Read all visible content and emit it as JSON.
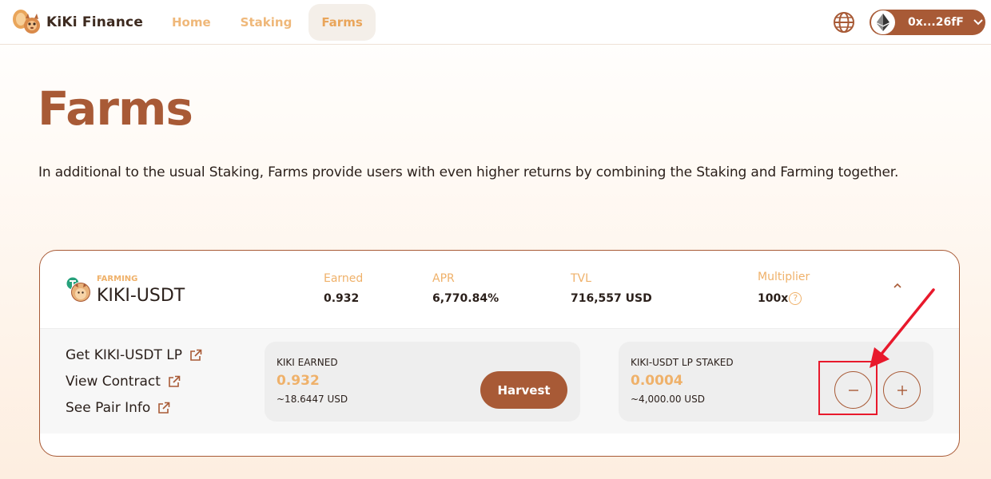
{
  "header": {
    "brand": "KiKi Finance",
    "nav": [
      {
        "label": "Home",
        "active": false
      },
      {
        "label": "Staking",
        "active": false
      },
      {
        "label": "Farms",
        "active": true
      }
    ],
    "wallet": {
      "address": "0x...26fF",
      "network_icon": "ethereum-icon"
    },
    "language_icon": "globe-icon"
  },
  "page": {
    "title": "Farms",
    "description": "In additional to the usual Staking, Farms provide users with even higher returns by combining the Staking and Farming together."
  },
  "farm": {
    "status_label": "FARMING",
    "pair": "KIKI-USDT",
    "stats": [
      {
        "label": "Earned",
        "value": "0.932"
      },
      {
        "label": "APR",
        "value": "6,770.84%"
      },
      {
        "label": "TVL",
        "value": "716,557 USD"
      },
      {
        "label": "Multiplier",
        "value": "100x"
      }
    ],
    "links": [
      {
        "label": "Get KIKI-USDT LP"
      },
      {
        "label": "View Contract"
      },
      {
        "label": "See Pair Info"
      }
    ],
    "earned_panel": {
      "label": "KIKI EARNED",
      "value": "0.932",
      "usd": "~18.6447 USD",
      "button": "Harvest"
    },
    "staked_panel": {
      "label": "KIKI-USDT LP STAKED",
      "value": "0.0004",
      "usd": "~4,000.00 USD"
    }
  },
  "colors": {
    "brand": "#a85a36",
    "accent": "#efb16a",
    "annotation": "#e8192c"
  }
}
